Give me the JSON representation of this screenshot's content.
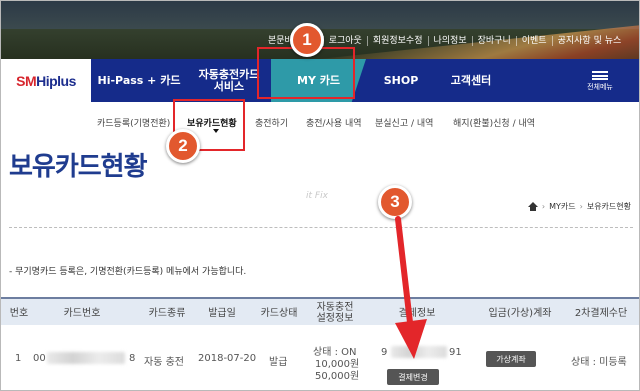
{
  "topbar": {
    "links": [
      "본문바로가기",
      "로그아웃",
      "회원정보수정",
      "나의정보",
      "장바구니",
      "이벤트",
      "공지사항 및 뉴스"
    ]
  },
  "logo": {
    "text_red": "SM",
    "text_blue": "Hiplus"
  },
  "nav": {
    "items": [
      "Hi-Pass + 카드",
      "자동충전카드\n서비스",
      "MY 카드",
      "SHOP",
      "고객센터"
    ],
    "all_menu": "전체메뉴"
  },
  "subnav": {
    "items": [
      "카드등록(기명전환)",
      "보유카드현황",
      "충전하기",
      "충전/사용 내역",
      "분실신고 / 내역",
      "해지(환불)신청 / 내역"
    ]
  },
  "page": {
    "title": "보유카드현황",
    "watermark": "it Fix",
    "breadcrumb": [
      "MY카드",
      "보유카드현황"
    ],
    "notice": "- 무기명카드 등록은, 기명전환(카드등록) 메뉴에서 가능합니다."
  },
  "table": {
    "headers": [
      "번호",
      "카드번호",
      "카드종류",
      "발급일",
      "카드상태",
      "자동충전\n설정정보",
      "결제정보",
      "입금(가상)계좌",
      "2차결제수단"
    ],
    "row": {
      "no": "1",
      "card_prefix": "00",
      "card_suffix": "8",
      "type": "자동 충전",
      "issued": "2018-07-20",
      "status": "발급",
      "auto_status": "상태 : ON",
      "auto_amount1": "10,000원",
      "auto_amount2": "50,000원",
      "pay_prefix": "9",
      "pay_suffix": "91",
      "pay_button": "결제변경",
      "virtual_button": "가상계좌",
      "second_pay": "상태 : 미등록"
    }
  },
  "annotations": [
    "1",
    "2",
    "3"
  ],
  "colors": {
    "nav_bg": "#152b8a",
    "active_tab": "#2e9aa8",
    "title": "#1f3c8f",
    "annotation_red": "#e3262a",
    "badge": "#e2582e"
  }
}
